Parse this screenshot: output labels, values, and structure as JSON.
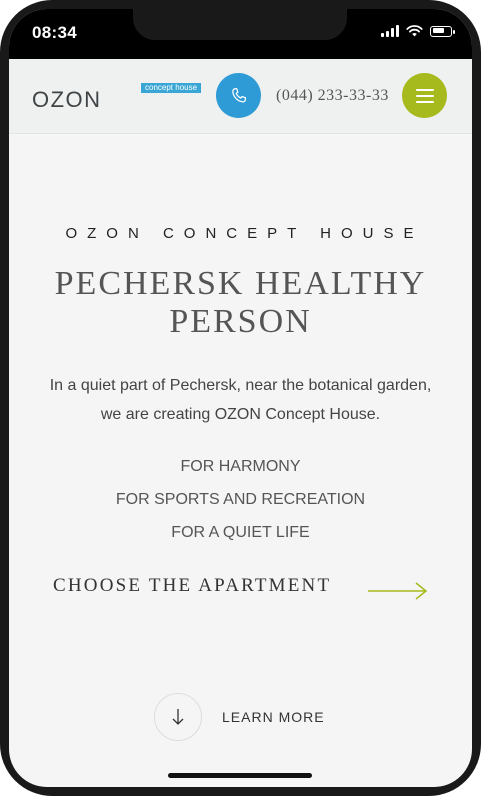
{
  "status_bar": {
    "time": "08:34"
  },
  "header": {
    "logo_text": "OZON",
    "logo_badge": "concept house",
    "phone_number": "(044) 233-33-33"
  },
  "hero": {
    "eyebrow": "OZON CONCEPT HOUSE",
    "title": "PECHERSK HEALTHY PERSON",
    "intro": "In a quiet part of Pechersk, near the botanical garden, we are creating OZON Concept House.",
    "features": [
      "FOR HARMONY",
      "FOR SPORTS AND RECREATION",
      "FOR A QUIET LIFE"
    ],
    "cta_label": "CHOOSE THE APARTMENT",
    "learn_more_label": "LEARN MORE"
  },
  "colors": {
    "phone_button": "#2e9bd6",
    "menu_button": "#a6b91d",
    "logo_badge": "#3aa6d6",
    "cta_arrow": "#a6b91d"
  },
  "icons": [
    "phone-icon",
    "menu-icon",
    "arrow-right-icon",
    "arrow-down-icon",
    "signal-icon",
    "wifi-icon",
    "battery-icon"
  ]
}
